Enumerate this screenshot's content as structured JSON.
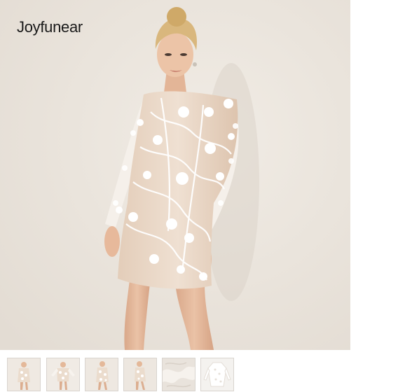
{
  "product": {
    "brand_logo_text": "Joyfunear",
    "main_image": "woman-in-white-lace-long-sleeve-mini-dress",
    "colors": {
      "backdrop": "#ece6de",
      "dress_lace": "#ffffff",
      "dress_lining": "#e8d6c6",
      "skin": "#e7bea0",
      "hair": "#d9b77d"
    }
  },
  "thumbnails": [
    {
      "image": "dress-front-thumbnail"
    },
    {
      "image": "dress-front-arms-out-thumbnail"
    },
    {
      "image": "dress-front-pose-thumbnail"
    },
    {
      "image": "dress-side-pose-thumbnail"
    },
    {
      "image": "lace-fabric-detail-thumbnail"
    },
    {
      "image": "dress-flat-thumbnail"
    }
  ]
}
